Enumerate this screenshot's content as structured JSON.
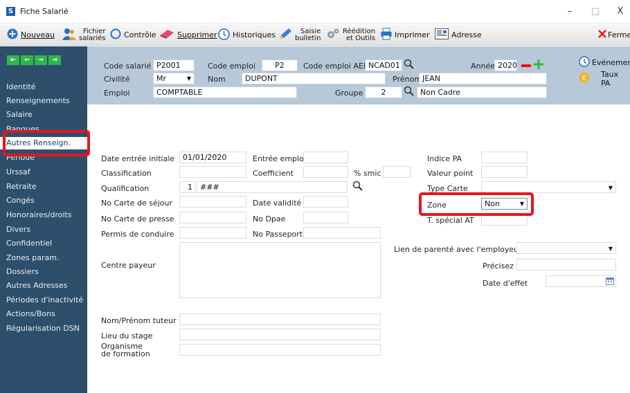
{
  "window": {
    "title": "Fiche Salarié",
    "app_icon": "S",
    "minimize": "–",
    "maximize": "□",
    "close": "X"
  },
  "toolbar": {
    "nouveau": "Nouveau",
    "fichier_line1": "Fichier",
    "fichier_line2": "salariés",
    "controle": "Contrôle",
    "supprimer": "Supprimer",
    "historiques": "Historiques",
    "saisie_line1": "Saisie",
    "saisie_line2": "bulletin",
    "reedition_line1": "Réédition",
    "reedition_line2": "et Outils",
    "imprimer": "Imprimer",
    "adresse": "Adresse",
    "fermer": "Ferme"
  },
  "sidebar": {
    "items": [
      "Identité",
      "Renseignements",
      "Salaire",
      "Banques",
      "Autres Renseign.",
      "Période",
      "Urssaf",
      "Retraite",
      "Congés",
      "Honoraires/droits",
      "Divers",
      "Confidentiel",
      "Zones param.",
      "Dossiers",
      "Autres Adresses",
      "Périodes d'inactivité",
      "Actions/Bons",
      "Régularisation DSN"
    ],
    "active_index": 4
  },
  "header": {
    "code_salarie_label": "Code salarié",
    "code_salarie": "P2001",
    "code_emploi_label": "Code emploi",
    "code_emploi": "P2",
    "code_emploi_aem_label": "Code emploi AEM",
    "code_emploi_aem": "NCAD01",
    "annee_label": "Année",
    "annee": "2020",
    "civilite_label": "Civilité",
    "civilite": "Mr",
    "nom_label": "Nom",
    "nom": "DUPONT",
    "prenom_label": "Prénom",
    "prenom": "JEAN",
    "emploi_label": "Emploi",
    "emploi": "COMPTABLE",
    "groupe_label": "Groupe",
    "groupe": "2",
    "groupe_desc": "Non Cadre",
    "evenements": "Evénemen",
    "taux_pa": "Taux PA"
  },
  "form": {
    "date_entree_initiale_label": "Date entrée initiale",
    "date_entree_initiale": "01/01/2020",
    "entree_emploi_label": "Entrée emploi",
    "entree_emploi": "",
    "classification_label": "Classification",
    "classification": "",
    "coefficient_label": "Coefficient",
    "coefficient": "",
    "smic_label": "% smic",
    "smic": "",
    "qualification_label": "Qualification",
    "qualification_code": "1",
    "qualification_desc": "###",
    "carte_sejour_label": "No Carte de séjour",
    "carte_sejour": "",
    "date_validite_label": "Date validité",
    "date_validite": "",
    "carte_presse_label": "No Carte de presse",
    "carte_presse": "",
    "no_dpae_label": "No Dpae",
    "no_dpae": "",
    "permis_label": "Permis de conduire",
    "permis": "",
    "passeport_label": "No Passeport",
    "passeport": "",
    "centre_payeur_label": "Centre payeur",
    "centre_payeur": "",
    "indice_pa_label": "Indice PA",
    "indice_pa": "",
    "valeur_point_label": "Valeur point",
    "valeur_point": "",
    "type_carte_label": "Type Carte",
    "type_carte": "",
    "zone_label": "Zone",
    "zone": "Non",
    "special_at_label": "T. spécial AT",
    "special_at": "",
    "lien_parente_label": "Lien de parenté avec l'employeur",
    "lien_parente": "",
    "precisez_label": "Précisez",
    "precisez": "",
    "date_effet_label": "Date d'effet",
    "date_effet": "",
    "tuteur_label": "Nom/Prénom tuteur",
    "tuteur": "",
    "lieu_stage_label": "Lieu du stage",
    "lieu_stage": "",
    "organisme_line1": "Organisme",
    "organisme_line2": "de formation",
    "organisme": ""
  },
  "colors": {
    "sidebar_bg": "#2d4f6c",
    "header_bg": "#b7c9d9",
    "highlight": "#e8141b",
    "accent_green": "#2fb84a"
  }
}
